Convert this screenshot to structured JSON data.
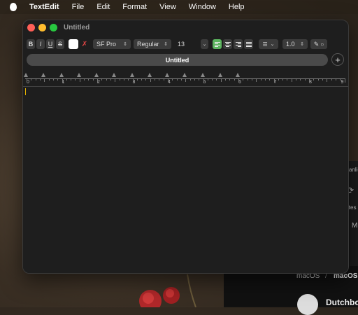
{
  "menubar": {
    "app_name": "TextEdit",
    "items": [
      "File",
      "Edit",
      "Format",
      "View",
      "Window",
      "Help"
    ]
  },
  "window": {
    "title": "Untitled",
    "tab_label": "Untitled",
    "new_tab_symbol": "+"
  },
  "toolbar": {
    "bold": "B",
    "italic": "I",
    "underline": "U",
    "strikethrough": "S",
    "font_family": "SF Pro",
    "font_style": "Regular",
    "font_size": "13",
    "line_spacing": "1.0",
    "text_color": "#ffffff",
    "active_alignment": "left"
  },
  "ruler": {
    "numbers": [
      "0",
      "1",
      "2",
      "3",
      "4",
      "5",
      "6",
      "7",
      "8",
      "9"
    ]
  },
  "background": {
    "breadcrumb_1": "macOS",
    "breadcrumb_sep": "/",
    "breadcrumb_2": "macOS",
    "author": "Dutchbo",
    "fragment_1": "anlie",
    "fragment_2": "ites",
    "fragment_3": "M"
  },
  "colors": {
    "accent_alignment": "#5bb45e",
    "cursor": "#e4b000",
    "window_bg": "#1e1e1e"
  }
}
